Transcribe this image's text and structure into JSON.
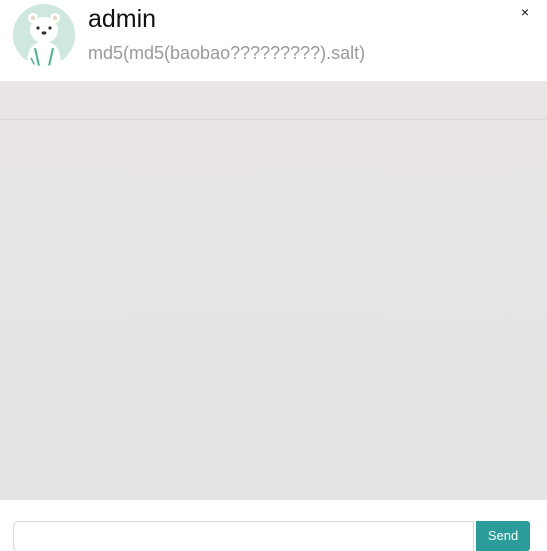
{
  "chat": {
    "user_name": "admin",
    "signature": "md5(md5(baobao?????????).salt)",
    "close_label": "×"
  },
  "avatar": {
    "icon": "polar-bear-avatar",
    "background_color": "#cfe8df"
  },
  "input": {
    "value": "",
    "placeholder": ""
  },
  "send": {
    "label": "Send",
    "color": "#2a9d9a"
  }
}
